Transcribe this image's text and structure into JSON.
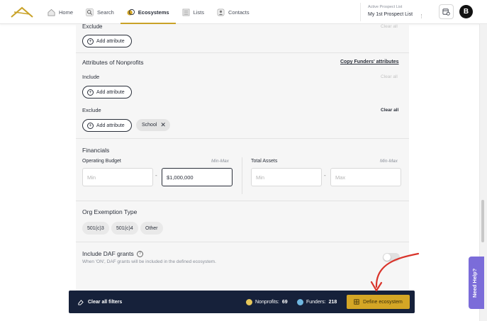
{
  "nav": {
    "home": "Home",
    "search": "Search",
    "ecosystems": "Ecosystems",
    "lists": "Lists",
    "contacts": "Contacts"
  },
  "prospect": {
    "label": "Active Prospect List",
    "value": "My 1st Prospect List"
  },
  "avatar": "B",
  "funders_exclude": {
    "title": "Exclude",
    "clear": "Clear all",
    "add_label": "Add attribute"
  },
  "nonprofits": {
    "title": "Attributes of Nonprofits",
    "copy_link": "Copy Funders' attributes",
    "include": {
      "title": "Include",
      "clear": "Clear all",
      "add_label": "Add attribute"
    },
    "exclude": {
      "title": "Exclude",
      "clear": "Clear all",
      "add_label": "Add attribute",
      "chip": "School"
    }
  },
  "financials": {
    "title": "Financials",
    "operating_budget": {
      "label": "Operating Budget",
      "hint": "Min-Max",
      "min_placeholder": "Min",
      "max_value": "$1,000,000"
    },
    "total_assets": {
      "label": "Total Assets",
      "hint": "Min-Max",
      "min_placeholder": "Min",
      "max_placeholder": "Max"
    },
    "dash": "-"
  },
  "exemption": {
    "title": "Org Exemption Type",
    "options": [
      "501(c)3",
      "501(c)4",
      "Other"
    ]
  },
  "daf": {
    "title": "Include DAF grants",
    "description": "When 'ON', DAF grants will be included in the defined ecosystem.",
    "enabled": false
  },
  "bottom_bar": {
    "clear_filters": "Clear all filters",
    "nonprofits_label": "Nonprofits:",
    "nonprofits_count": "69",
    "funders_label": "Funders:",
    "funders_count": "218",
    "define_button": "Define ecosystem"
  },
  "need_help": "Need Help?",
  "colors": {
    "accent": "#d4a625",
    "navy": "#16213a",
    "help": "#7b6cd9",
    "annotation": "#d9342b"
  }
}
